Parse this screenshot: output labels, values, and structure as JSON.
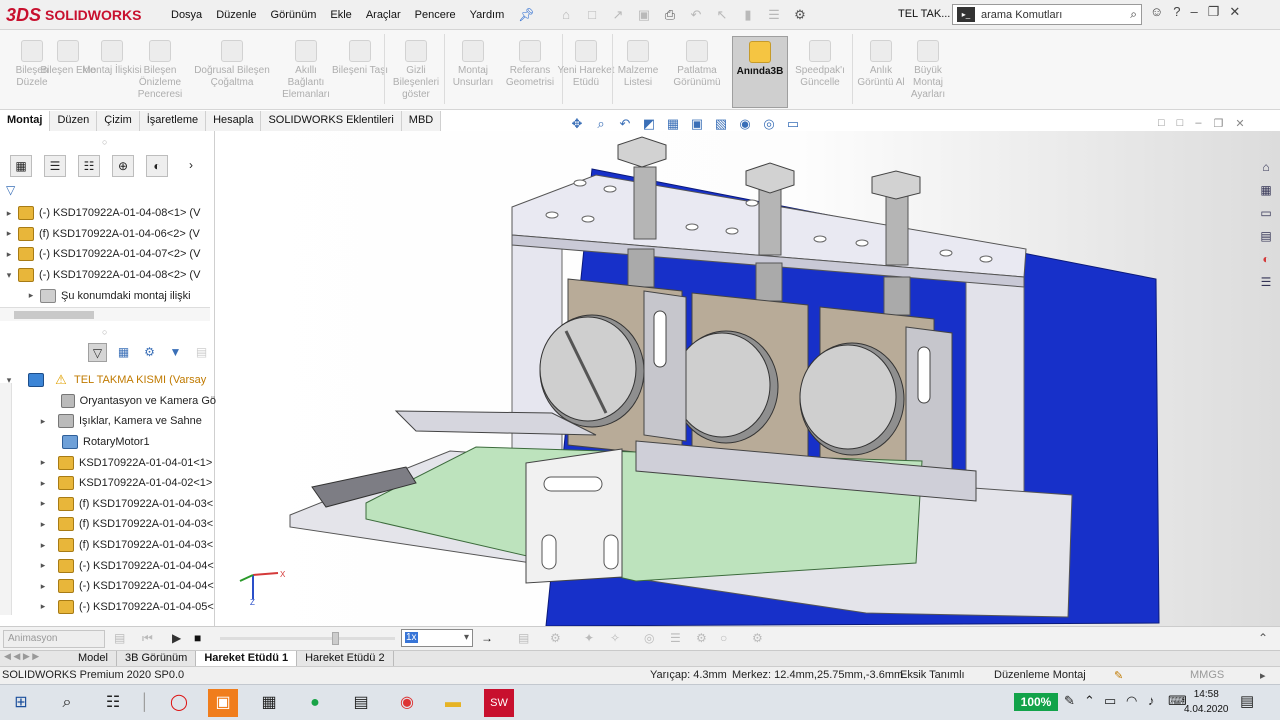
{
  "app": {
    "brand_prefix": "3DS",
    "brand": "SOLIDWORKS"
  },
  "menu": [
    "Dosya",
    "Düzenle",
    "Görünüm",
    "Ekle",
    "Araçlar",
    "Pencere",
    "Yardım"
  ],
  "doc_title": "TEL TAK...",
  "search": {
    "tag": "▸_",
    "placeholder": "arama Komutları"
  },
  "commands": [
    {
      "label": "Bileşen Düzele",
      "active": false
    },
    {
      "label": "Bileşen Ekle",
      "active": false
    },
    {
      "label": "Montaj İlişkisi",
      "active": false
    },
    {
      "label": "Bileşen Önizleme Penceresi",
      "active": false
    },
    {
      "label": "Doğrusal Bileşen Çoğaltma",
      "active": false
    },
    {
      "label": "Akıllı Bağlantı Elemanları",
      "active": false
    },
    {
      "label": "Bileşeni Taşı",
      "active": false
    },
    {
      "label": "Gizli Bileşenleri göster",
      "active": false
    },
    {
      "label": "Montaj Unsurları",
      "active": false
    },
    {
      "label": "Referans Geometrisi",
      "active": false
    },
    {
      "label": "Yeni Hareket Etüdü",
      "active": false
    },
    {
      "label": "Malzeme Listesi",
      "active": false
    },
    {
      "label": "Patlatma Görünümü",
      "active": false
    },
    {
      "label": "Anında3B",
      "active": true
    },
    {
      "label": "Speedpak'ı Güncelle",
      "active": false
    },
    {
      "label": "Anlık Görüntü Al",
      "active": false
    },
    {
      "label": "Büyük Montaj Ayarları",
      "active": false
    }
  ],
  "cm_tabs": [
    "Montaj",
    "Düzen",
    "Çizim",
    "İşaretleme",
    "Hesapla",
    "SOLIDWORKS Eklentileri",
    "MBD"
  ],
  "tree_top": [
    {
      "arrow": "▸",
      "icon": "comp",
      "text": "(-) KSD170922A-01-04-08<1> (V"
    },
    {
      "arrow": "▸",
      "icon": "comp",
      "text": "(f) KSD170922A-01-04-06<2> (V"
    },
    {
      "arrow": "▸",
      "icon": "comp",
      "text": "(-) KSD170922A-01-04-07<2> (V"
    },
    {
      "arrow": "▾",
      "icon": "comp",
      "text": "(-) KSD170922A-01-04-08<2> (V"
    },
    {
      "arrow": "▸",
      "icon": "mate",
      "text": "Şu konumdaki montaj ilişki",
      "indent": true
    }
  ],
  "tree_bottom": [
    {
      "arrow": "▾",
      "icon": "asm",
      "warn": true,
      "text": "TEL TAKMA KISMI",
      "suffix": "(Varsay"
    },
    {
      "arrow": "",
      "icon": "gray",
      "text": "Oryantasyon ve Kamera Gö"
    },
    {
      "arrow": "▸",
      "icon": "gray",
      "text": "Işıklar, Kamera ve Sahne"
    },
    {
      "arrow": "",
      "icon": "blue",
      "text": "RotaryMotor1"
    },
    {
      "arrow": "▸",
      "icon": "comp",
      "text": "KSD170922A-01-04-01<1>"
    },
    {
      "arrow": "▸",
      "icon": "comp",
      "text": "KSD170922A-01-04-02<1>"
    },
    {
      "arrow": "▸",
      "icon": "comp",
      "text": "(f) KSD170922A-01-04-03<"
    },
    {
      "arrow": "▸",
      "icon": "comp",
      "text": "(f) KSD170922A-01-04-03<"
    },
    {
      "arrow": "▸",
      "icon": "comp",
      "text": "(f) KSD170922A-01-04-03<"
    },
    {
      "arrow": "▸",
      "icon": "comp",
      "text": "(-) KSD170922A-01-04-04<"
    },
    {
      "arrow": "▸",
      "icon": "comp",
      "text": "(-) KSD170922A-01-04-04<"
    },
    {
      "arrow": "▸",
      "icon": "comp",
      "text": "(-) KSD170922A-01-04-05<"
    }
  ],
  "motion": {
    "study_type": "Animasyon",
    "speed": "1x"
  },
  "bottom_tabs": [
    "Model",
    "3B Görünüm",
    "Hareket Etüdü 1",
    "Hareket Etüdü 2"
  ],
  "status": {
    "product": "SOLIDWORKS Premium 2020 SP0.0",
    "radius": "Yarıçap: 4.3mm",
    "center": "Merkez: 12.4mm,25.75mm,-3.6mm",
    "defined": "Eksik Tanımlı",
    "mode": "Düzenleme Montaj",
    "units": "MMGS"
  },
  "taskbar": {
    "battery": "100%",
    "time": "14:58",
    "date": "4.04.2020"
  },
  "colors": {
    "brand": "#c8102e",
    "accent": "#3875d7",
    "battery": "#12a34a",
    "backplate": "#1730c9",
    "pcb": "#bde3bd"
  }
}
